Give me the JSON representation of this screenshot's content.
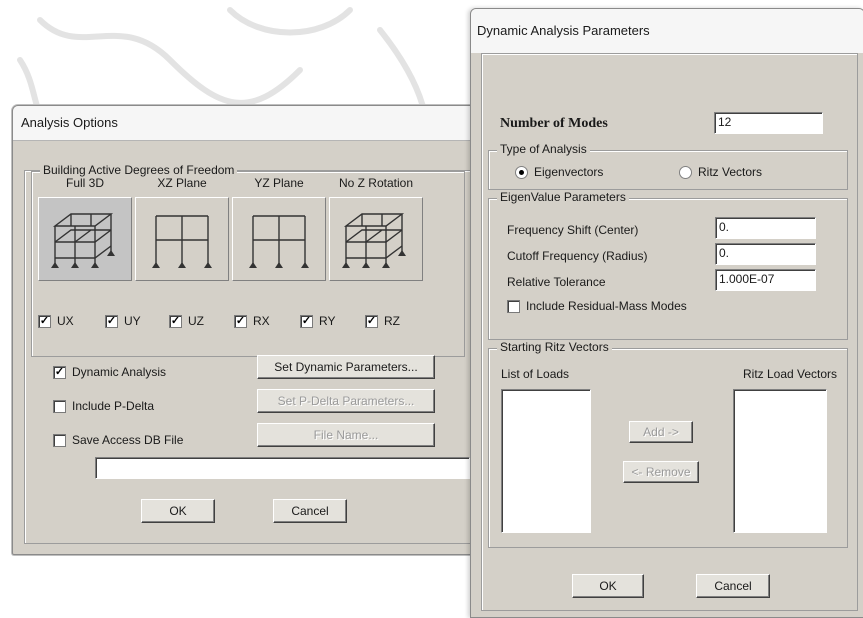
{
  "analysis_options": {
    "title": "Analysis Options",
    "dof_group_label": "Building Active Degrees of Freedom",
    "frames": [
      {
        "label": "Full 3D",
        "icon": "frame-3d-icon"
      },
      {
        "label": "XZ Plane",
        "icon": "frame-xz-icon"
      },
      {
        "label": "YZ Plane",
        "icon": "frame-yz-icon"
      },
      {
        "label": "No Z Rotation",
        "icon": "frame-noz-icon"
      }
    ],
    "dofs": [
      {
        "label": "UX",
        "checked": true
      },
      {
        "label": "UY",
        "checked": true
      },
      {
        "label": "UZ",
        "checked": true
      },
      {
        "label": "RX",
        "checked": true
      },
      {
        "label": "RY",
        "checked": true
      },
      {
        "label": "RZ",
        "checked": true
      }
    ],
    "dynamic_analysis": {
      "label": "Dynamic Analysis",
      "checked": true
    },
    "include_pdelta": {
      "label": "Include P-Delta",
      "checked": false
    },
    "save_access_db": {
      "label": "Save Access DB File",
      "checked": false
    },
    "set_dynamic_button": "Set Dynamic Parameters...",
    "set_pdelta_button": "Set P-Delta Parameters...",
    "file_name_button": "File Name...",
    "file_path": "",
    "ok_button": "OK",
    "cancel_button": "Cancel"
  },
  "dynamic_params": {
    "title": "Dynamic Analysis Parameters",
    "num_modes_label": "Number of Modes",
    "num_modes_value": "12",
    "type_group_label": "Type of Analysis",
    "eigenvectors_label": "Eigenvectors",
    "ritz_label": "Ritz Vectors",
    "selected_type": "eigenvectors",
    "eigen_group_label": "EigenValue Parameters",
    "freq_shift_label": "Frequency Shift  (Center)",
    "freq_shift_value": "0.",
    "cutoff_label": "Cutoff Frequency  (Radius)",
    "cutoff_value": "0.",
    "tolerance_label": "Relative Tolerance",
    "tolerance_value": "1.000E-07",
    "residual_label": "Include Residual-Mass Modes",
    "residual_checked": false,
    "ritz_group_label": "Starting Ritz Vectors",
    "list_loads_label": "List of Loads",
    "ritz_load_label": "Ritz Load Vectors",
    "add_button": "Add ->",
    "remove_button": "<- Remove",
    "ok_button": "OK",
    "cancel_button": "Cancel"
  }
}
